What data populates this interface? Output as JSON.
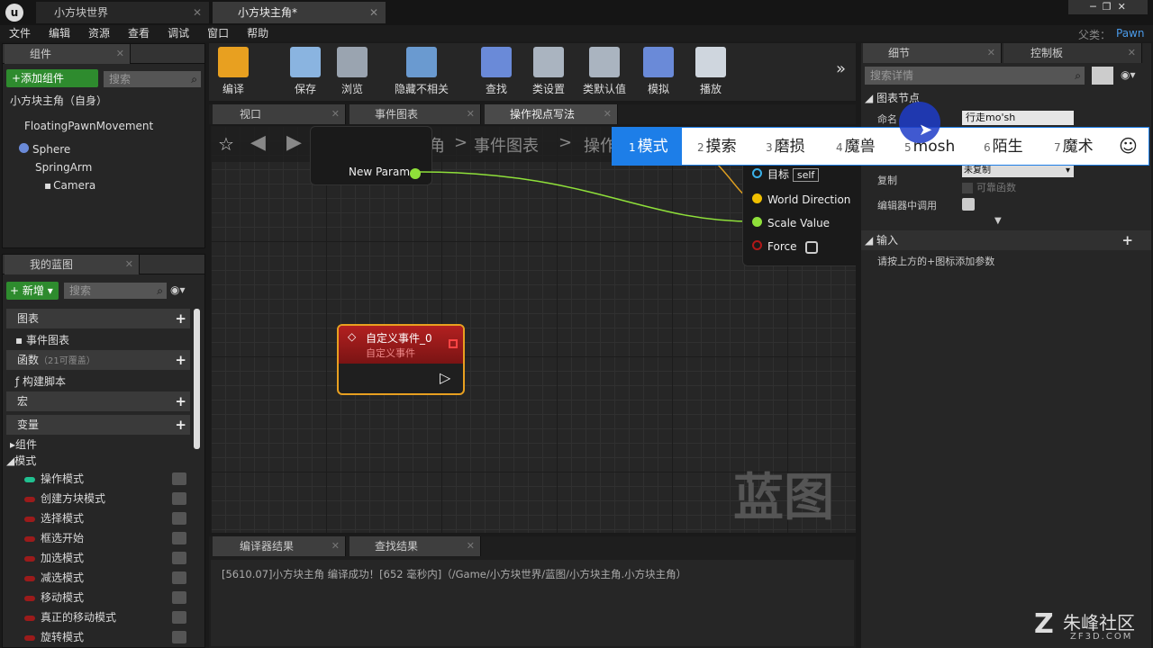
{
  "window": {
    "tabs": [
      "小方块世界",
      "小方块主角*"
    ],
    "parent_label": "父类：",
    "parent_value": "Pawn"
  },
  "menu": [
    "文件",
    "编辑",
    "资源",
    "查看",
    "调试",
    "窗口",
    "帮助"
  ],
  "components": {
    "title": "组件",
    "add_button": "+添加组件",
    "search_placeholder": "搜索",
    "root": "小方块主角（自身）",
    "items": [
      "FloatingPawnMovement",
      "Sphere",
      "SpringArm",
      "Camera"
    ]
  },
  "myblueprint": {
    "title": "我的蓝图",
    "new_button": "新增",
    "search_placeholder": "搜索",
    "sections": {
      "graphs": "图表",
      "event_graph": "事件图表",
      "functions": "函数",
      "functions_count": "（21可覆盖）",
      "construct": "构建脚本",
      "macros": "宏",
      "variables": "变量",
      "components": "组件",
      "modes": "模式"
    },
    "vars": [
      "操作模式",
      "创建方块模式",
      "选择模式",
      "框选开始",
      "加选模式",
      "减选模式",
      "移动模式",
      "真正的移动模式",
      "旋转模式"
    ]
  },
  "toolbar": [
    "编译",
    "保存",
    "浏览",
    "隐藏不相关",
    "查找",
    "类设置",
    "类默认值",
    "模拟",
    "播放"
  ],
  "doc_tabs": [
    "视口",
    "事件图表",
    "操作视点写法"
  ],
  "breadcrumb": [
    "小方块主角",
    "事件图表",
    "操作"
  ],
  "graph": {
    "param": "New Param",
    "pins": [
      "目标",
      "World Direction",
      "Scale Value",
      "Force"
    ],
    "self": "self",
    "event_title": "自定义事件_0",
    "event_sub": "自定义事件",
    "watermark": "蓝图"
  },
  "bottom": {
    "tabs": [
      "编译器结果",
      "查找结果"
    ],
    "log": "[5610.07]小方块主角 编译成功！[652 毫秒内]（/Game/小方块世界/蓝图/小方块主角.小方块主角）"
  },
  "details": {
    "tabs": [
      "细节",
      "控制板"
    ],
    "search_placeholder": "搜索详情",
    "section": "图表节点",
    "name_label": "命名",
    "name_value": "行走mo'sh",
    "replicate_label": "复制",
    "replicate_value": "未复制",
    "reliable_label": "可靠函数",
    "editor_call": "编辑器中调用",
    "inputs": "输入",
    "inputs_hint": "请按上方的+图标添加参数"
  },
  "ime": {
    "candidates": [
      [
        "1",
        "模式"
      ],
      [
        "2",
        "摸索"
      ],
      [
        "3",
        "磨损"
      ],
      [
        "4",
        "魔兽"
      ],
      [
        "5",
        "mosh"
      ],
      [
        "6",
        "陌生"
      ],
      [
        "7",
        "魔术"
      ]
    ]
  },
  "brand": {
    "name": "朱峰社区",
    "url": "ZF3D.COM"
  },
  "colors": {
    "accent": "#1d7ee8",
    "green": "#2e8b2e",
    "exec_red": "#9b1b1b",
    "pin_green": "#8fe03a"
  }
}
